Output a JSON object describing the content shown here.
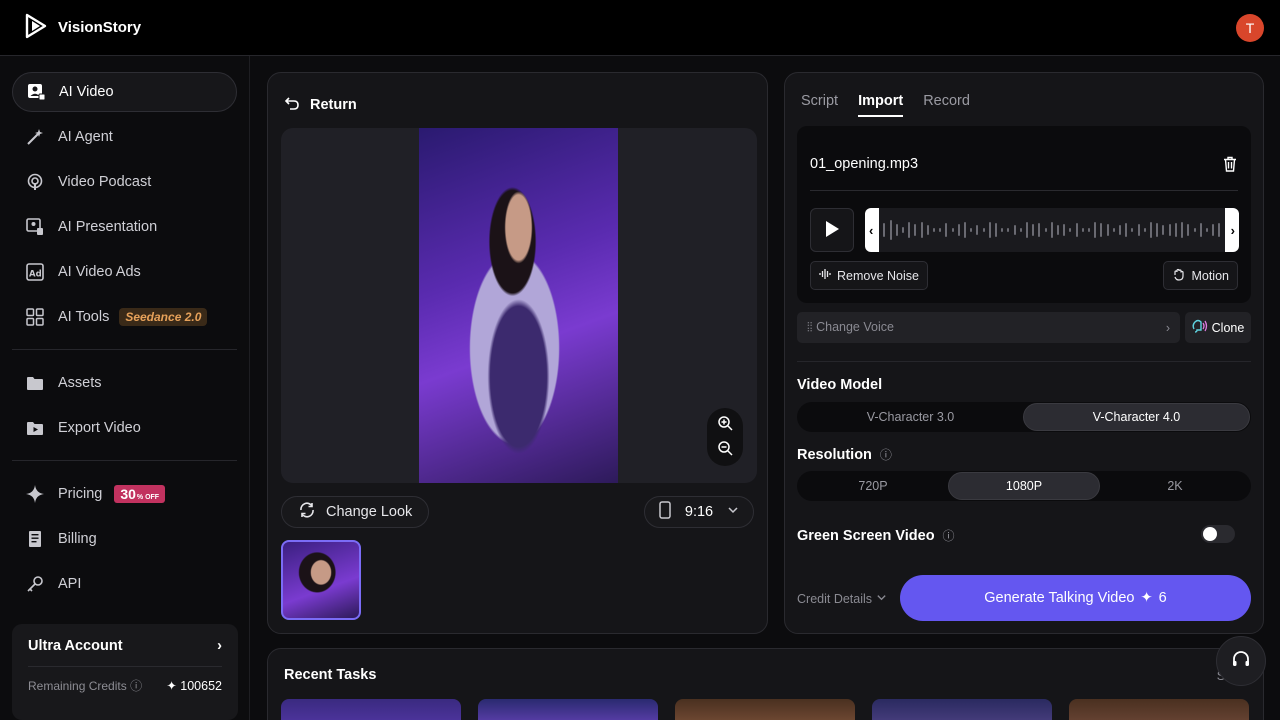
{
  "app": {
    "name": "VisionStory",
    "avatar_letter": "T",
    "avatar_color": "#d9462b",
    "accent": "#6457f0"
  },
  "sidebar": {
    "items": [
      {
        "label": "AI Video",
        "icon": "user-video-icon",
        "active": true
      },
      {
        "label": "AI Agent",
        "icon": "magic-wand-icon"
      },
      {
        "label": "Video Podcast",
        "icon": "podcast-icon"
      },
      {
        "label": "AI Presentation",
        "icon": "presentation-icon"
      },
      {
        "label": "AI Video Ads",
        "icon": "ad-icon"
      },
      {
        "label": "AI Tools",
        "icon": "grid-icon",
        "badge": "Seedance 2.0"
      }
    ],
    "items2": [
      {
        "label": "Assets",
        "icon": "folder-icon"
      },
      {
        "label": "Export Video",
        "icon": "export-folder-icon"
      }
    ],
    "items3": [
      {
        "label": "Pricing",
        "icon": "sparkle-icon",
        "badge": "30",
        "badge_small": "% OFF"
      },
      {
        "label": "Billing",
        "icon": "receipt-icon"
      },
      {
        "label": "API",
        "icon": "key-icon"
      }
    ],
    "account": {
      "title": "Ultra Account",
      "credits_label": "Remaining Credits",
      "credits_value": "100652"
    }
  },
  "preview": {
    "return_label": "Return",
    "change_look_label": "Change Look",
    "aspect_ratio": "9:16"
  },
  "right": {
    "tabs": [
      "Script",
      "Import",
      "Record"
    ],
    "active_tab": "Import",
    "file_name": "01_opening.mp3",
    "remove_noise_label": "Remove Noise",
    "motion_label": "Motion",
    "change_voice_label": "Change Voice",
    "clone_label": "Clone",
    "video_model_label": "Video Model",
    "models": [
      "V-Character 3.0",
      "V-Character 4.0"
    ],
    "selected_model": "V-Character 4.0",
    "resolution_label": "Resolution",
    "resolutions": [
      "720P",
      "1080P",
      "2K"
    ],
    "selected_resolution": "1080P",
    "green_screen_label": "Green Screen Video",
    "green_screen_on": false,
    "credit_details_label": "Credit Details",
    "generate_label": "Generate Talking Video",
    "generate_cost": "6"
  },
  "recent": {
    "title": "Recent Tasks",
    "see_all": "See"
  }
}
